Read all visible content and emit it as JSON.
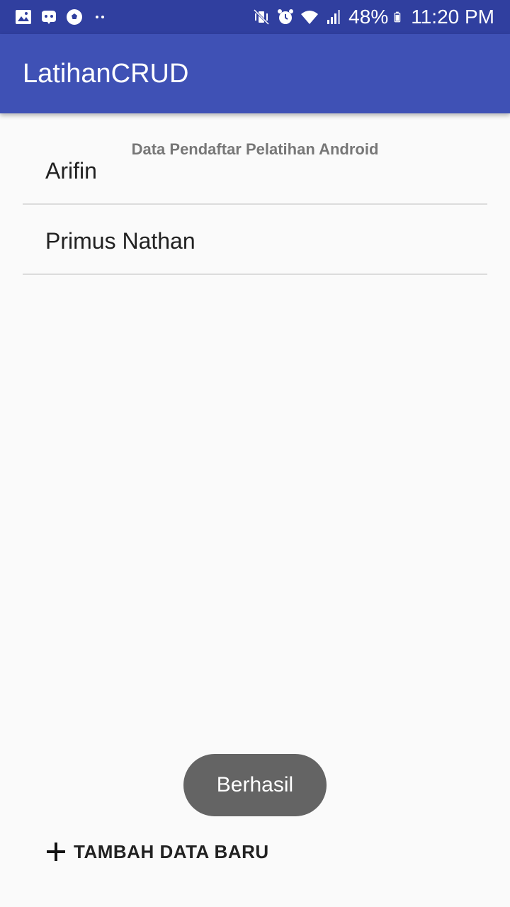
{
  "status_bar": {
    "battery_percent": "48%",
    "time": "11:20 PM",
    "left_icons": [
      "gallery-icon",
      "game-icon",
      "ball-icon",
      "more-dots-icon"
    ],
    "right_icons": [
      "mute-vibrate-icon",
      "alarm-icon",
      "wifi-icon",
      "signal-icon",
      "battery-icon"
    ]
  },
  "app_bar": {
    "title": "LatihanCRUD",
    "color": "#3f51b5",
    "status_color": "#303f9f"
  },
  "main": {
    "header": "Data Pendaftar Pelatihan Android",
    "items": [
      {
        "label": "Arifin"
      },
      {
        "label": "Primus Nathan"
      }
    ]
  },
  "toast": {
    "text": "Berhasil"
  },
  "add_button": {
    "label": "TAMBAH DATA BARU",
    "icon": "plus-icon"
  }
}
